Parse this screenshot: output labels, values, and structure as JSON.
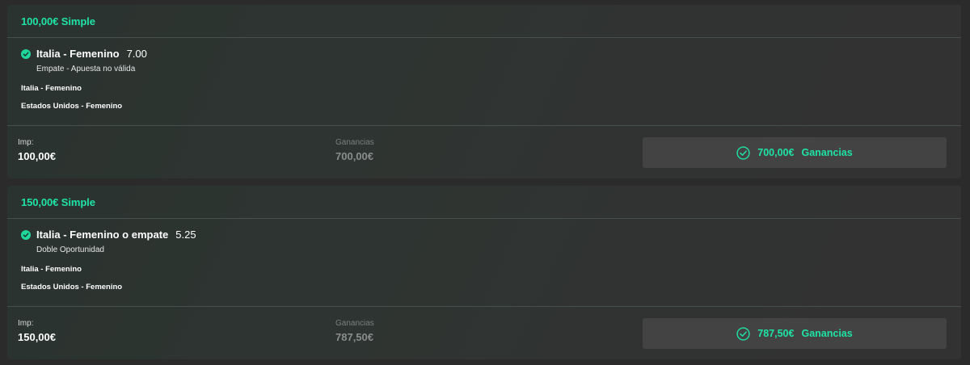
{
  "bets": [
    {
      "title": "100,00€ Simple",
      "selection": {
        "name": "Italia - Femenino",
        "odds": "7.00",
        "market": "Empate - Apuesta no válida",
        "status_icon": "check-circle-icon"
      },
      "teams": [
        "Italia - Femenino",
        "Estados Unidos - Femenino"
      ],
      "stake_label": "Imp:",
      "stake_value": "100,00€",
      "winnings_label": "Ganancias",
      "winnings_value": "700,00€",
      "result": {
        "amount": "700,00€",
        "label": "Ganancias",
        "icon": "check-circle-outline-icon"
      }
    },
    {
      "title": "150,00€ Simple",
      "selection": {
        "name": "Italia - Femenino o empate",
        "odds": "5.25",
        "market": "Doble Oportunidad",
        "status_icon": "check-circle-icon"
      },
      "teams": [
        "Italia - Femenino",
        "Estados Unidos - Femenino"
      ],
      "stake_label": "Imp:",
      "stake_value": "150,00€",
      "winnings_label": "Ganancias",
      "winnings_value": "787,50€",
      "result": {
        "amount": "787,50€",
        "label": "Ganancias",
        "icon": "check-circle-outline-icon"
      }
    }
  ],
  "colors": {
    "accent": "#1fe3a6",
    "card_bg": "#2e3431",
    "button_bg": "#424342",
    "muted_text": "#8a8d8b"
  }
}
